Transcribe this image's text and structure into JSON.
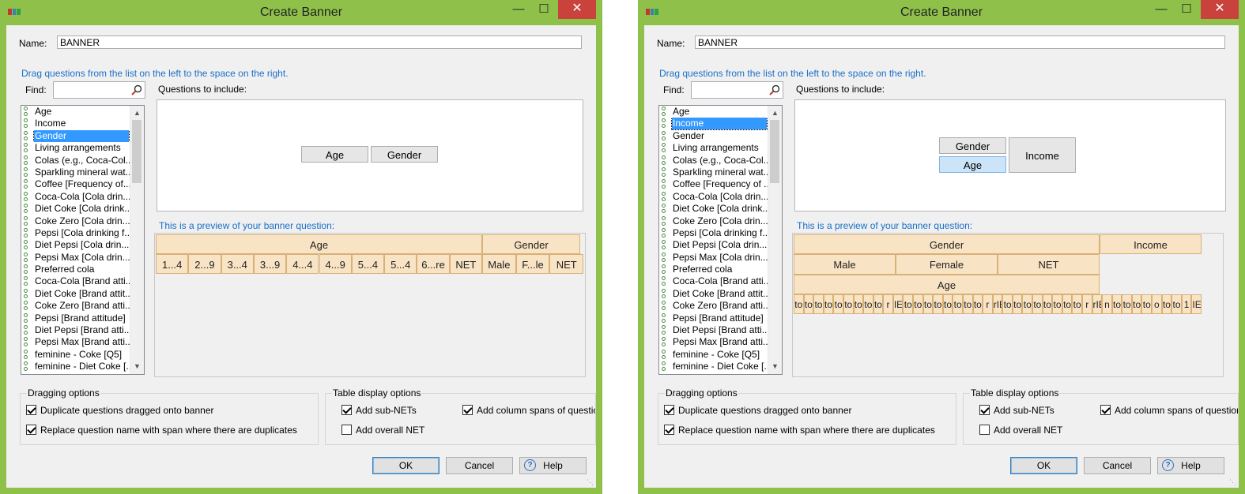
{
  "colors": {
    "frame": "#8fc14a",
    "close": "#c9423b",
    "accent": "#3399ff",
    "hint": "#1a70c9",
    "cell": "#f8e4c4"
  },
  "dialog_left": {
    "title": "Create Banner",
    "name_label": "Name:",
    "name_value": "BANNER",
    "hint": "Drag questions from the list on the left to the space on the right.",
    "find_label": "Find:",
    "questions_label": "Questions to include:",
    "questions": [
      "Age",
      "Income",
      "Gender",
      "Living arrangements",
      "Colas (e.g., Coca-Col...",
      "Sparkling mineral wat...",
      "Coffee [Frequency of...",
      "Coca-Cola [Cola drin...",
      "Diet Coke [Cola drink...",
      "Coke Zero [Cola drin...",
      "Pepsi [Cola drinking f...",
      "Diet Pepsi [Cola drin...",
      "Pepsi Max [Cola drin...",
      "Preferred cola",
      "Coca-Cola [Brand atti...",
      "Diet Coke [Brand attit...",
      "Coke Zero [Brand atti...",
      "Pepsi [Brand attitude]",
      "Diet Pepsi [Brand atti...",
      "Pepsi Max [Brand atti...",
      "feminine - Coke [Q5]",
      "feminine - Diet Coke [..."
    ],
    "selected_question": "Gender",
    "chips": [
      "Age",
      "Gender"
    ],
    "preview_label": "This is a preview of your banner question:",
    "preview": {
      "top": [
        "Age",
        "Gender"
      ],
      "sub": [
        "1...4",
        "2...9",
        "3...4",
        "3...9",
        "4...4",
        "4...9",
        "5...4",
        "5...4",
        "6...re",
        "NET",
        "Male",
        "F...le",
        "NET"
      ]
    },
    "dragging_title": "Dragging options",
    "dragging": [
      {
        "label": "Duplicate questions dragged onto banner",
        "checked": true
      },
      {
        "label": "Replace question name with span where there are duplicates",
        "checked": true
      }
    ],
    "table_title": "Table display options",
    "table": [
      {
        "label": "Add sub-NETs",
        "checked": true
      },
      {
        "label": "Add overall NET",
        "checked": false
      },
      {
        "label": "Add column spans of questions",
        "checked": true
      }
    ],
    "ok": "OK",
    "cancel": "Cancel",
    "help": "Help"
  },
  "dialog_right": {
    "title": "Create Banner",
    "name_label": "Name:",
    "name_value": "BANNER",
    "hint": "Drag questions from the list on the left to the space on the right.",
    "find_label": "Find:",
    "questions_label": "Questions to include:",
    "questions": [
      "Age",
      "Income",
      "Gender",
      "Living arrangements",
      "Colas (e.g., Coca-Col...",
      "Sparkling mineral wat...",
      "Coffee [Frequency of ...",
      "Coca-Cola [Cola drin...",
      "Diet Coke [Cola drink...",
      "Coke Zero [Cola drin...",
      "Pepsi [Cola drinking f...",
      "Diet Pepsi [Cola drin...",
      "Pepsi Max [Cola drin...",
      "Preferred cola",
      "Coca-Cola [Brand atti...",
      "Diet Coke [Brand attit...",
      "Coke Zero [Brand atti...",
      "Pepsi [Brand attitude]",
      "Diet Pepsi [Brand atti...",
      "Pepsi Max [Brand atti...",
      "feminine - Coke [Q5]",
      "feminine - Diet Coke [..."
    ],
    "selected_question": "Income",
    "chips": [
      "Gender",
      "Age",
      "Income"
    ],
    "preview_label": "This is a preview of your banner question:",
    "preview": {
      "row1": [
        "Gender",
        "Income"
      ],
      "row2": [
        "Male",
        "Female",
        "NET"
      ],
      "row3": "Age",
      "row4": [
        "to",
        "to",
        "to",
        "to",
        "to",
        "to",
        "to",
        "to",
        "to",
        "r",
        "IE",
        "to",
        "to",
        "to",
        "to",
        "to",
        "to",
        "to",
        "to",
        "r",
        "rIE",
        "to",
        "to",
        "to",
        "to",
        "to",
        "to",
        "to",
        "to",
        "r",
        "rIE",
        "n",
        "to",
        "to",
        "to",
        "to",
        "o",
        "to",
        "to",
        "1",
        "IE"
      ]
    },
    "dragging_title": "Dragging options",
    "dragging": [
      {
        "label": "Duplicate questions dragged onto banner",
        "checked": true
      },
      {
        "label": "Replace question name with span where there are duplicates",
        "checked": true
      }
    ],
    "table_title": "Table display options",
    "table": [
      {
        "label": "Add sub-NETs",
        "checked": true
      },
      {
        "label": "Add overall NET",
        "checked": false
      },
      {
        "label": "Add column spans of questions",
        "checked": true
      }
    ],
    "ok": "OK",
    "cancel": "Cancel",
    "help": "Help"
  }
}
